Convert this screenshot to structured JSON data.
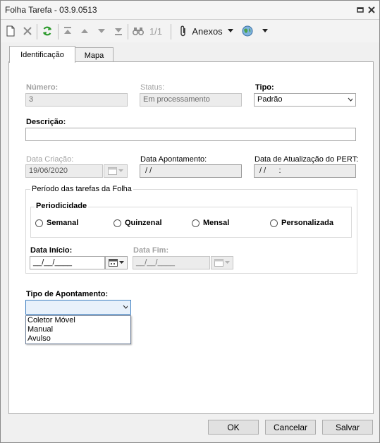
{
  "window": {
    "title": "Folha Tarefa - 03.9.0513"
  },
  "toolbar": {
    "page_indicator": "1/1",
    "attachments_label": "Anexos"
  },
  "tabs": [
    {
      "label": "Identificação"
    },
    {
      "label": "Mapa"
    }
  ],
  "form": {
    "numero": {
      "label": "Número:",
      "value": "3"
    },
    "status": {
      "label": "Status:",
      "value": "Em processamento"
    },
    "tipo": {
      "label": "Tipo:",
      "value": "Padrão"
    },
    "descricao": {
      "label": "Descrição:",
      "value": ""
    },
    "data_criacao": {
      "label": "Data Criação:",
      "value": "19/06/2020"
    },
    "data_apontamento": {
      "label": "Data Apontamento:",
      "value": " / /"
    },
    "data_pert": {
      "label": "Data de Atualização do PERT:",
      "value": " / /      :"
    },
    "periodo": {
      "title": "Período das tarefas da Folha",
      "periodicidade": {
        "title": "Periodicidade",
        "options": [
          "Semanal",
          "Quinzenal",
          "Mensal",
          "Personalizada"
        ]
      },
      "data_inicio": {
        "label": "Data Início:",
        "value": "__/__/____"
      },
      "data_fim": {
        "label": "Data Fim:",
        "value": "__/__/____"
      }
    },
    "tipo_apontamento": {
      "label": "Tipo de Apontamento:",
      "value": "",
      "options": [
        "Coletor Móvel",
        "Manual",
        "Avulso"
      ]
    }
  },
  "footer": {
    "ok": "OK",
    "cancel": "Cancelar",
    "save": "Salvar"
  }
}
